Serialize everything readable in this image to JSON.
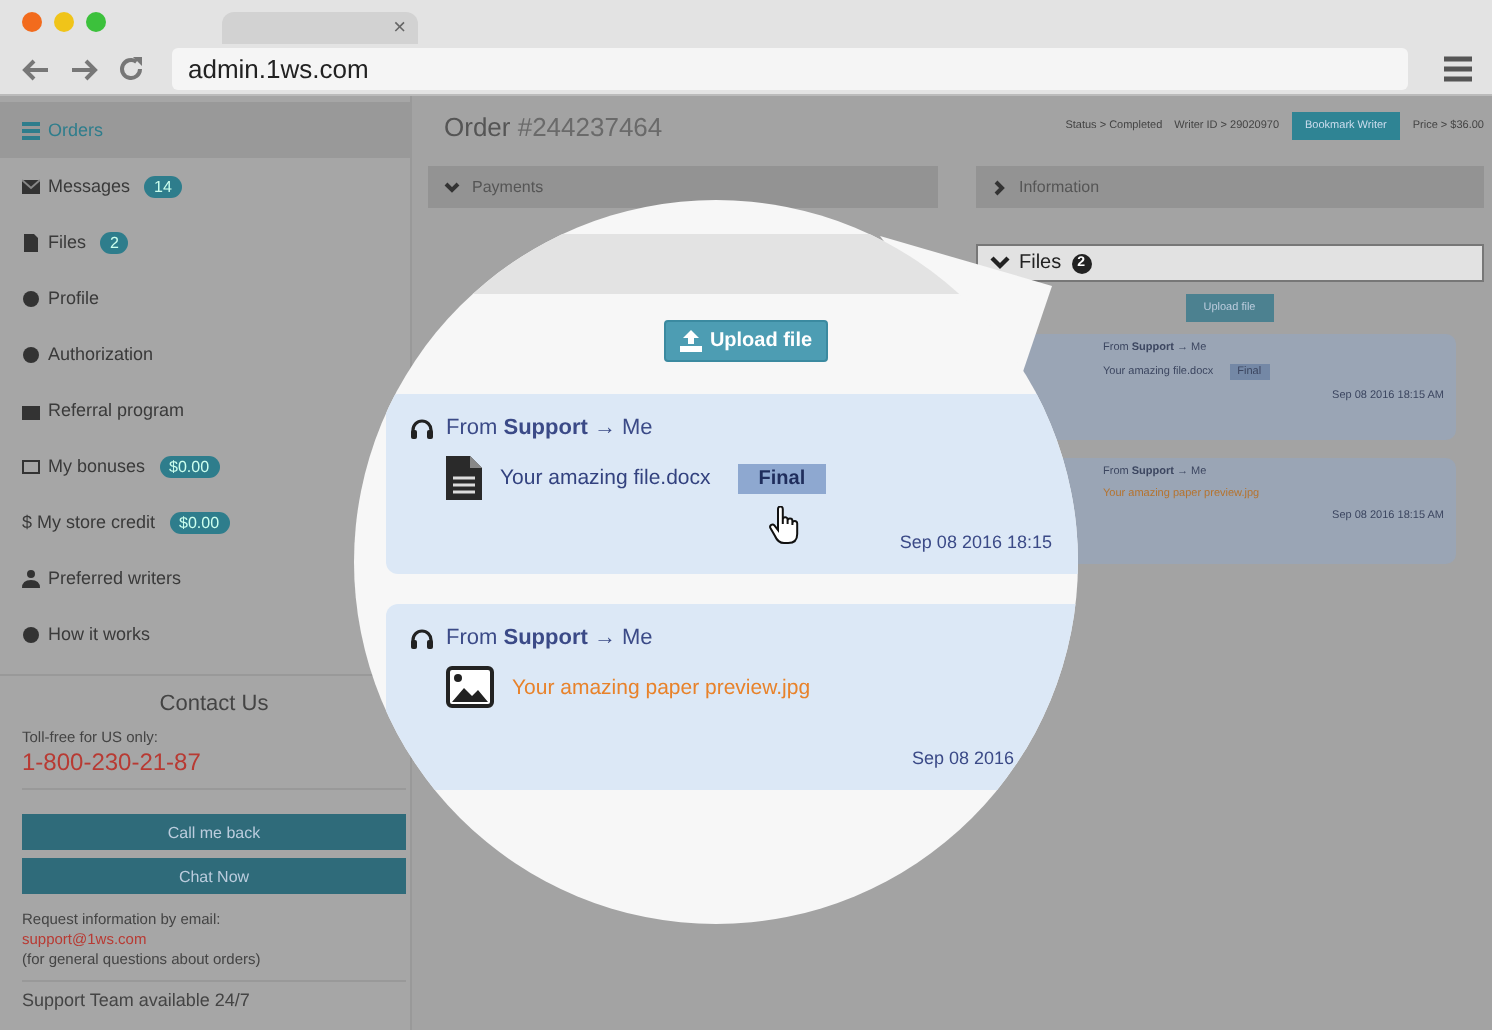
{
  "browser": {
    "tab_close": "×",
    "url": "admin.1ws.com"
  },
  "sidebar": {
    "items": [
      {
        "label": "Orders",
        "selected": true
      },
      {
        "label": "Messages",
        "badge": "14",
        "selected": false
      },
      {
        "label": "Files",
        "badge": "2",
        "selected": false
      },
      {
        "label": "Profile",
        "selected": false
      },
      {
        "label": "Authorization",
        "selected": false
      },
      {
        "label": "Referral program",
        "selected": false
      },
      {
        "label": "My bonuses",
        "badge": "$0.00",
        "selected": false
      },
      {
        "label": "$ My store credit",
        "badge": "$0.00",
        "selected": false
      },
      {
        "label": "Preferred writers",
        "selected": false
      },
      {
        "label": "How it works",
        "selected": false
      }
    ],
    "contact": {
      "title": "Contact Us",
      "phone_note": "Toll-free for US only:",
      "phone": "1-800-230-21-87",
      "buttons": [
        "Call me back",
        "Chat Now"
      ],
      "email_note": "Request information by email:",
      "email": "support@1ws.com",
      "email_hint": "(for general questions about orders)",
      "availability": "Support Team available 24/7"
    }
  },
  "order": {
    "title": "Order",
    "number": "#244237464",
    "status": "Status > Completed",
    "writer": "Writer ID > 29020970",
    "bookmark_button": "Bookmark Writer",
    "price": "Price > $36.00"
  },
  "panels": [
    {
      "title": "Payments",
      "expanded": true
    },
    {
      "title": "Information",
      "expanded": false
    }
  ],
  "files": {
    "title": "Files",
    "count": "2",
    "expanded": true,
    "upload_button": "Upload file",
    "messages": [
      {
        "from": "From **Support** → Me",
        "file": "Your amazing file.docx",
        "kind": "document",
        "tag": "Final",
        "time": "Sep 08 2016 18:15 AM"
      },
      {
        "from": "From **Support** → Me",
        "file": "Your amazing paper preview.jpg",
        "kind": "image",
        "time": "Sep 08 2016 18:15 AM"
      }
    ]
  },
  "magnifier": {
    "upload_button": "Upload file",
    "messages": [
      {
        "from": "From **Support** → Me",
        "file": "Your amazing file.docx",
        "kind": "document",
        "tag": "Final",
        "time": "Sep 08 2016 18:15"
      },
      {
        "from": "From **Support** → Me",
        "file": "Your amazing paper preview.jpg",
        "kind": "image",
        "time": "Sep 08 2016"
      }
    ]
  }
}
